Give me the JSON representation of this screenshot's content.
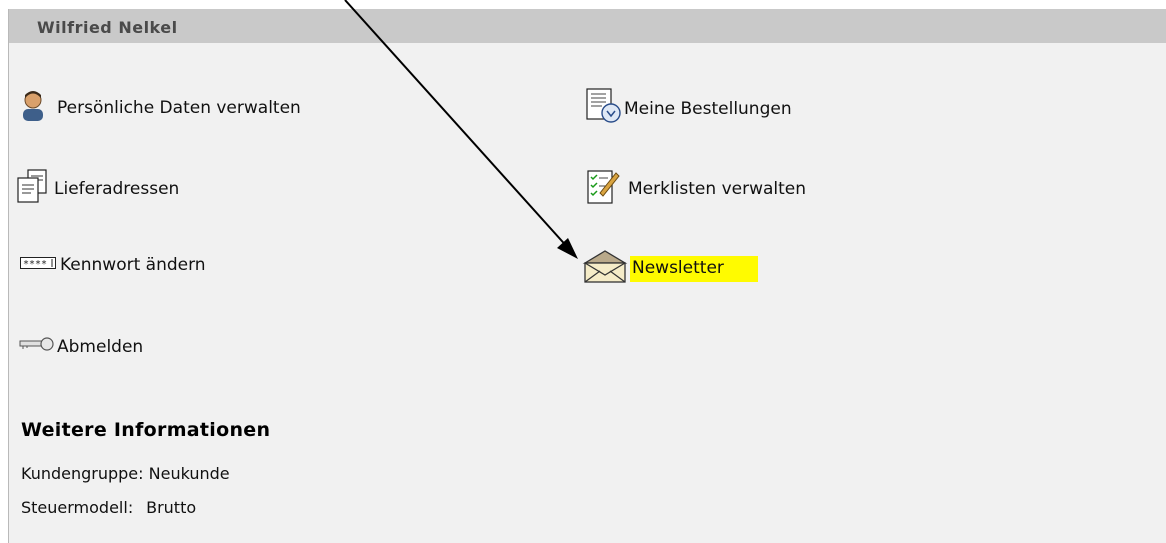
{
  "header": {
    "title": "Wilfried Nelkel"
  },
  "menu": {
    "left": [
      {
        "label": "Persönliche Daten verwalten",
        "icon": "person-icon"
      },
      {
        "label": "Lieferadressen",
        "icon": "address-document-icon"
      },
      {
        "label": "Kennwort ändern",
        "icon": "password-icon"
      },
      {
        "label": "Abmelden",
        "icon": "key-icon"
      }
    ],
    "right": [
      {
        "label": "Meine Bestellungen",
        "icon": "orders-icon"
      },
      {
        "label": "Merklisten verwalten",
        "icon": "checklist-icon"
      },
      {
        "label": "Newsletter",
        "icon": "envelope-icon"
      }
    ]
  },
  "info": {
    "title": "Weitere Informationen",
    "rows": [
      {
        "key": "Kundengruppe:",
        "value": "Neukunde"
      },
      {
        "key": "Steuermodell:",
        "value": "Brutto"
      }
    ]
  },
  "colors": {
    "highlight": "#fffb00",
    "header_bg": "#c9c9c9",
    "panel_bg": "#f1f1f1"
  }
}
